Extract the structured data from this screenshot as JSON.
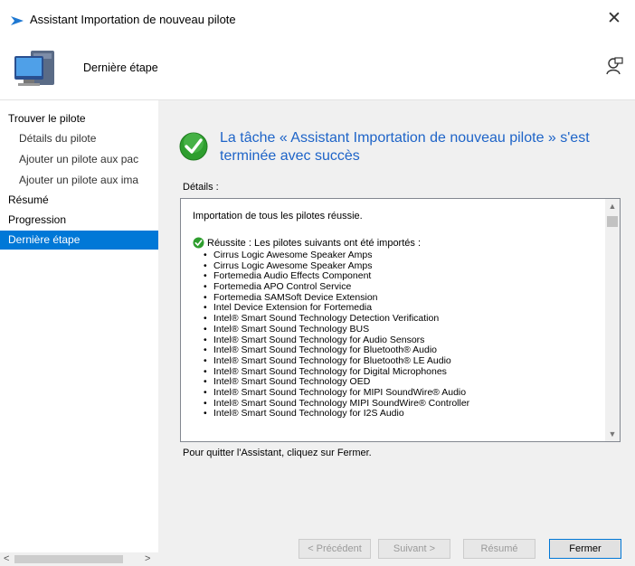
{
  "window": {
    "title": "Assistant Importation de nouveau pilote",
    "close_glyph": "✕",
    "title_icon": "arrow-icon"
  },
  "header": {
    "title": "Dernière étape",
    "icon": "computer-icon",
    "feedback_icon": "feedback-icon"
  },
  "sidebar": {
    "items": [
      {
        "label": "Trouver le pilote",
        "level": 0,
        "selected": false
      },
      {
        "label": "Détails du pilote",
        "level": 1,
        "selected": false
      },
      {
        "label": "Ajouter un pilote aux pac",
        "level": 1,
        "selected": false
      },
      {
        "label": "Ajouter un pilote aux ima",
        "level": 1,
        "selected": false
      },
      {
        "label": "Résumé",
        "level": 0,
        "selected": false
      },
      {
        "label": "Progression",
        "level": 0,
        "selected": false
      },
      {
        "label": "Dernière étape",
        "level": 0,
        "selected": true
      }
    ],
    "scroll_left": "<",
    "scroll_right": ">"
  },
  "main": {
    "success_message": "La tâche « Assistant Importation de nouveau pilote » s'est terminée avec succès",
    "details_label": "Détails :",
    "details": {
      "import_line": "Importation de tous les pilotes réussie.",
      "success_line": "Réussite : Les pilotes suivants ont été importés :",
      "drivers": [
        "Cirrus Logic Awesome Speaker Amps",
        "Cirrus Logic Awesome Speaker Amps",
        "Fortemedia Audio Effects Component",
        "Fortemedia APO Control Service",
        "Fortemedia SAMSoft Device Extension",
        "Intel Device Extension for Fortemedia",
        "Intel® Smart Sound Technology Detection Verification",
        "Intel® Smart Sound Technology BUS",
        "Intel® Smart Sound Technology for Audio Sensors",
        "Intel® Smart Sound Technology for Bluetooth® Audio",
        "Intel® Smart Sound Technology for Bluetooth® LE Audio",
        "Intel® Smart Sound Technology for Digital Microphones",
        "Intel® Smart Sound Technology OED",
        "Intel® Smart Sound Technology for MIPI SoundWire® Audio",
        "Intel® Smart Sound Technology MIPI SoundWire® Controller",
        "Intel® Smart Sound Technology for I2S Audio"
      ]
    },
    "quit_text": "Pour quitter l'Assistant, cliquez sur Fermer."
  },
  "buttons": {
    "previous": "< Précédent",
    "next": "Suivant >",
    "summary": "Résumé",
    "close": "Fermer"
  },
  "colors": {
    "accent": "#0078d7",
    "success_text": "#1e64c8",
    "success_green": "#2e9e2e"
  }
}
